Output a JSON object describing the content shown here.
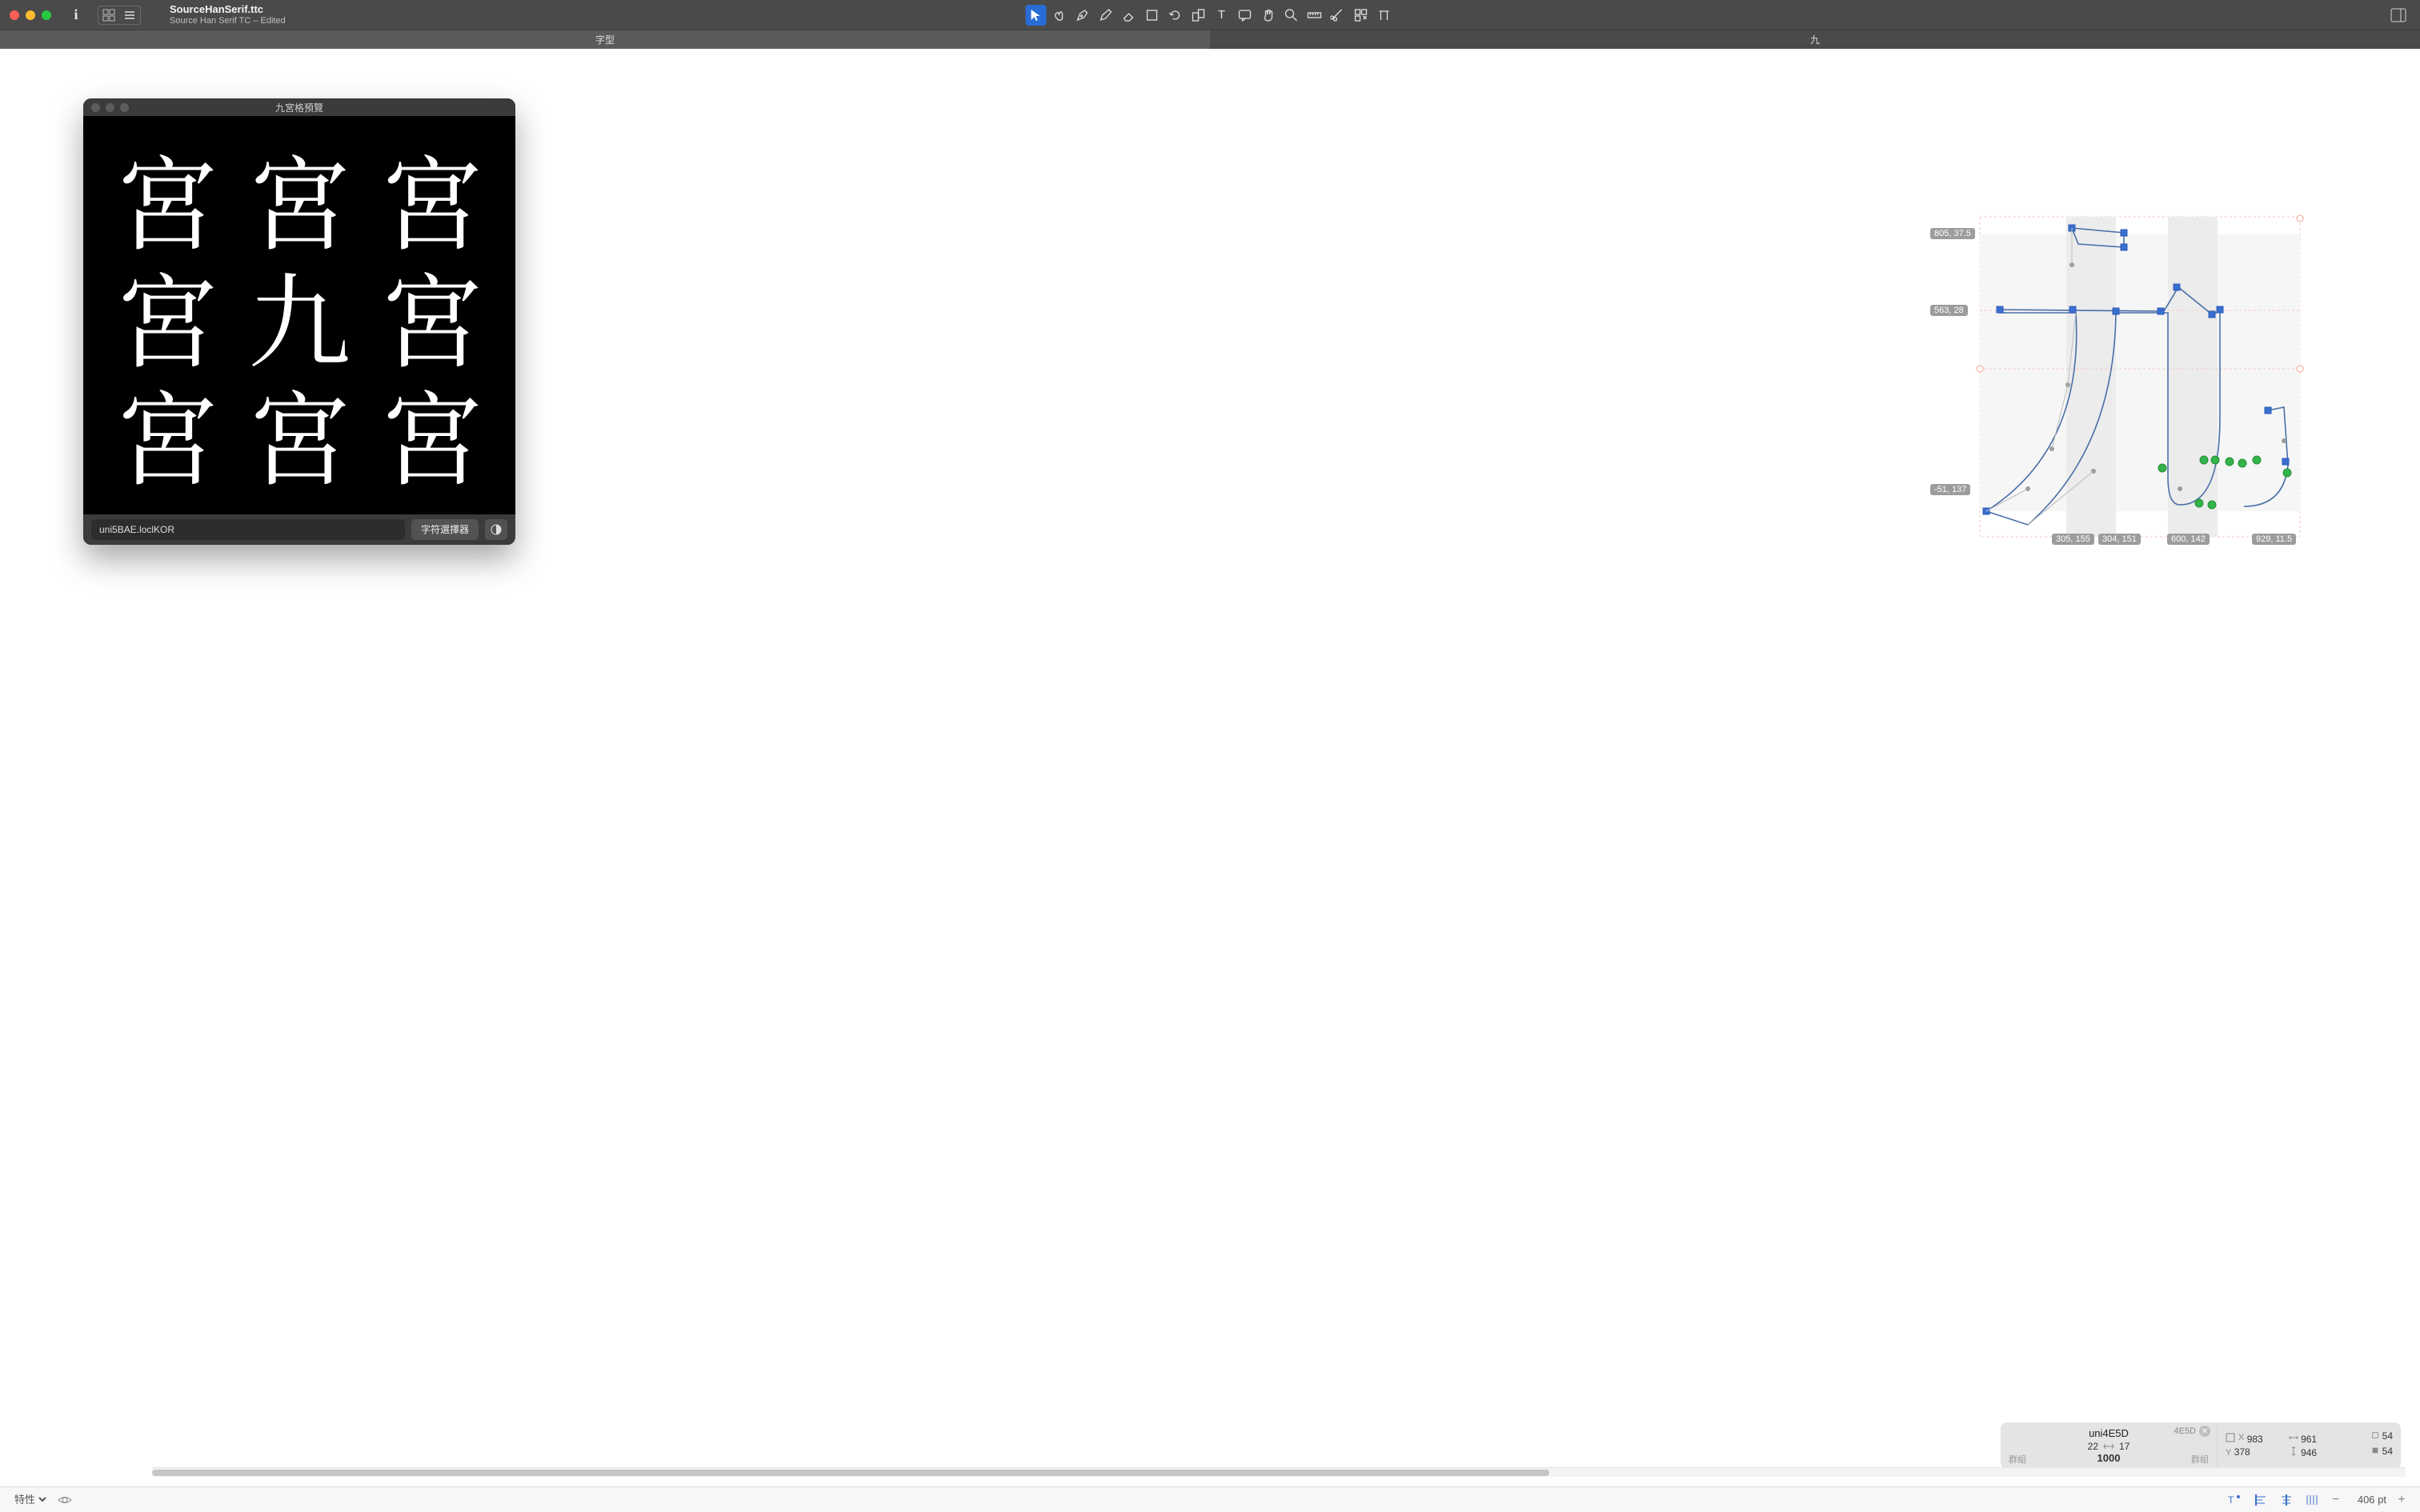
{
  "app": {
    "filename": "SourceHanSerif.ttc",
    "subtitle": "Source Han Serif TC – Edited"
  },
  "tabs": [
    {
      "label": "字型",
      "active": false
    },
    {
      "label": "九",
      "active": true
    }
  ],
  "preview": {
    "title": "九宮格預覽",
    "glyphs": [
      "宮",
      "宮",
      "宮",
      "宮",
      "九",
      "宮",
      "宮",
      "宮",
      "宮"
    ],
    "input_value": "uni5BAE.loclKOR",
    "picker_button": "字符選擇器"
  },
  "editor_labels": {
    "p1": "805, 37.5",
    "p2": "563, 28",
    "p3": "-51, 137",
    "p4": "305, 155",
    "p5": "304, 151",
    "p6": "600, 142",
    "p7": "929, 11.5"
  },
  "glyph_info": {
    "name": "uni4E5D",
    "unicode": "4E5D",
    "lsb": "22",
    "rsb": "17",
    "advance": "1000",
    "group_left": "群組",
    "group_right": "群組",
    "x": "983",
    "y": "378",
    "w": "961",
    "h": "946",
    "seg1": "54",
    "seg2": "54"
  },
  "statusbar": {
    "mode": "特性",
    "zoom": "406 pt"
  }
}
